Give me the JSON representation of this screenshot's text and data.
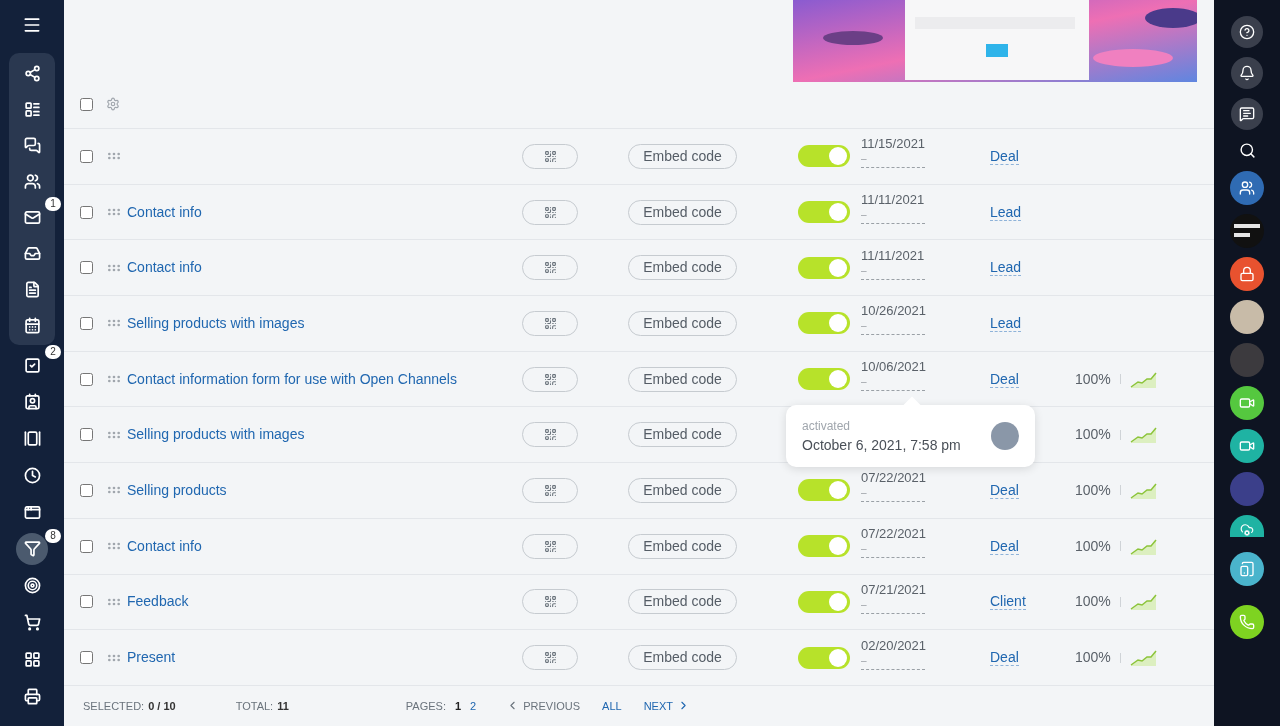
{
  "sidebar": {
    "pinned": [
      {
        "selected": false
      },
      {
        "selected": false
      },
      {
        "selected": false
      },
      {
        "selected": false
      },
      {
        "selected": false,
        "badge": "1"
      },
      {
        "selected": false
      },
      {
        "selected": false
      },
      {
        "selected": false
      }
    ],
    "items": [
      {
        "selected": false,
        "badge": "2"
      },
      {
        "selected": false
      },
      {
        "selected": false
      },
      {
        "selected": false
      },
      {
        "selected": false
      },
      {
        "selected": true,
        "badge": "8"
      },
      {
        "selected": false
      },
      {
        "selected": false
      },
      {
        "selected": false
      },
      {
        "selected": false
      }
    ]
  },
  "header": {
    "select_all_checked": false
  },
  "table": {
    "rows": [
      {
        "checked": false,
        "name": "",
        "embed": "Embed code",
        "on": true,
        "date": "11/15/2021",
        "sub": "–",
        "type": "Deal"
      },
      {
        "checked": false,
        "name": "Contact info",
        "embed": "Embed code",
        "on": true,
        "date": "11/11/2021",
        "sub": "–",
        "type": "Lead"
      },
      {
        "checked": false,
        "name": "Contact info",
        "embed": "Embed code",
        "on": true,
        "date": "11/11/2021",
        "sub": "–",
        "type": "Lead"
      },
      {
        "checked": false,
        "name": "Selling products with images",
        "embed": "Embed code",
        "on": true,
        "date": "10/26/2021",
        "sub": "–",
        "type": "Lead"
      },
      {
        "checked": false,
        "name": "Contact information form for use with Open Channels",
        "embed": "Embed code",
        "on": true,
        "date": "10/06/2021",
        "sub": "–",
        "type": "Deal",
        "percent": "100%"
      },
      {
        "checked": false,
        "name": "Selling products with images",
        "embed": "Embed code",
        "percent": "100%"
      },
      {
        "checked": false,
        "name": "Selling products",
        "embed": "Embed code",
        "on": true,
        "date": "07/22/2021",
        "sub": "–",
        "type": "Deal",
        "percent": "100%"
      },
      {
        "checked": false,
        "name": "Contact info",
        "embed": "Embed code",
        "on": true,
        "date": "07/22/2021",
        "sub": "–",
        "type": "Deal",
        "percent": "100%"
      },
      {
        "checked": false,
        "name": "Feedback",
        "embed": "Embed code",
        "on": true,
        "date": "07/21/2021",
        "sub": "–",
        "type": "Client",
        "percent": "100%"
      },
      {
        "checked": false,
        "name": "Present",
        "embed": "Embed code",
        "on": true,
        "date": "02/20/2021",
        "sub": "–",
        "type": "Deal",
        "percent": "100%"
      }
    ]
  },
  "tooltip": {
    "label": "activated",
    "value": "October 6, 2021, 7:58 pm"
  },
  "footer": {
    "selected_label": "SELECTED:",
    "selected_value": "0 / 10",
    "total_label": "TOTAL:",
    "total_value": "11",
    "pages_label": "PAGES:",
    "pages": [
      {
        "label": "1",
        "selected": true
      },
      {
        "label": "2",
        "selected": false
      }
    ],
    "previous": "PREVIOUS",
    "all": "ALL",
    "next": "NEXT"
  }
}
